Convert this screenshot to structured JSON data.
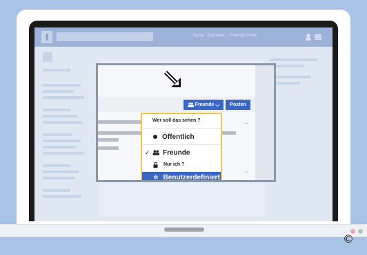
{
  "facebook_background": {
    "logo": "f",
    "top_links": [
      "Name",
      "Startseite",
      "Freunde finden"
    ]
  },
  "post_actions": {
    "friends_button_label": "Freunde",
    "post_button_label": "Posten"
  },
  "audience_dropdown": {
    "title": "Wer soll das sehen ?",
    "items": [
      {
        "label": "Öffentlich",
        "icon": "dot-icon",
        "selected": false
      },
      {
        "label": "Freunde",
        "icon": "people-icon",
        "checked": true
      },
      {
        "label": "Nur ich ?",
        "icon": "lock-icon",
        "selected": false
      },
      {
        "label": "Benutzerdefiniert",
        "icon": "gear-icon",
        "highlighted": true
      }
    ]
  },
  "copyright_symbol": "©",
  "colors": {
    "facebook_blue": "#3b67c4",
    "dropdown_border": "#f0c44a",
    "background": "#a8c3e6"
  }
}
